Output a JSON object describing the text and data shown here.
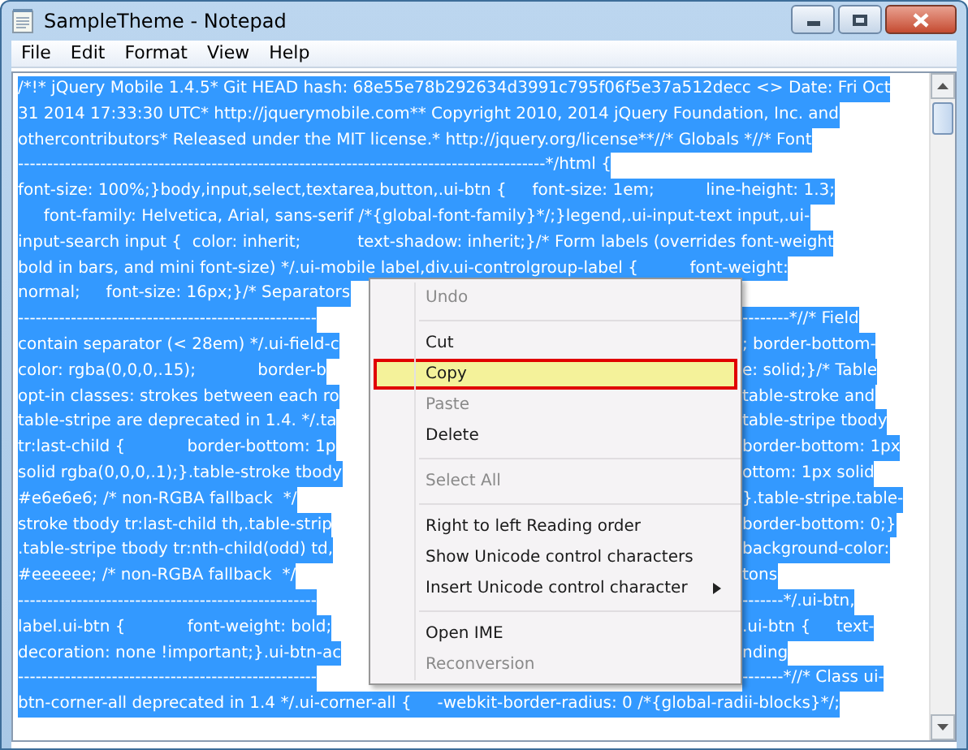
{
  "window": {
    "title": "SampleTheme - Notepad"
  },
  "menu_bar": [
    {
      "label": "File"
    },
    {
      "label": "Edit"
    },
    {
      "label": "Format"
    },
    {
      "label": "View"
    },
    {
      "label": "Help"
    }
  ],
  "editor": {
    "lines": [
      {
        "kind": "full",
        "text": "/*!* jQuery Mobile 1.4.5* Git HEAD hash: 68e55e78b292634d3991c795f06f5e37a512decc <> Date: Fri Oct"
      },
      {
        "kind": "full",
        "text": "31 2014 17:33:30 UTC* http://jquerymobile.com** Copyright 2010, 2014 jQuery Foundation, Inc. and"
      },
      {
        "kind": "full",
        "text": "othercontributors* Released under the MIT license.* http://jquery.org/license**//* Globals *//* Font"
      },
      {
        "kind": "full",
        "text": "------------------------------------------------------------------------------------------*/html {"
      },
      {
        "kind": "full",
        "text": "font-size: 100%;}body,input,select,textarea,button,.ui-btn {     font-size: 1em;          line-height: 1.3;"
      },
      {
        "kind": "full",
        "text": "     font-family: Helvetica, Arial, sans-serif /*{global-font-family}*/;}legend,.ui-input-text input,.ui-"
      },
      {
        "kind": "full",
        "text": "input-search input {  color: inherit;           text-shadow: inherit;}/* Form labels (overrides font-weight"
      },
      {
        "kind": "full",
        "text": "bold in bars, and mini font-size) */.ui-mobile label,div.ui-controlgroup-label {          font-weight:"
      },
      {
        "kind": "split",
        "left": "normal;     font-size: 16px;}/* Separators"
      },
      {
        "kind": "split",
        "left": "---------------------------------------------------",
        "right": "--------*//* Field"
      },
      {
        "kind": "split",
        "left": "contain separator (< 28em) */.ui-field-c",
        "right": "; border-bottom-"
      },
      {
        "kind": "split",
        "left": "color: rgba(0,0,0,.15);            border-b",
        "right": "e: solid;}/* Table"
      },
      {
        "kind": "split",
        "left": "opt-in classes: strokes between each ro",
        "right": "table-stroke and"
      },
      {
        "kind": "split",
        "left": "table-stripe are deprecated in 1.4. */.ta",
        "right": "table-stripe tbody"
      },
      {
        "kind": "split",
        "left": "tr:last-child {            border-bottom: 1p",
        "right": "border-bottom: 1px"
      },
      {
        "kind": "split",
        "left": "solid rgba(0,0,0,.1);}.table-stroke tbody",
        "right": "ottom: 1px solid"
      },
      {
        "kind": "split",
        "left": "#e6e6e6; /* non-RGBA fallback  */",
        "right": "}.table-stripe.table-"
      },
      {
        "kind": "split",
        "left": "stroke tbody tr:last-child th,.table-strip",
        "right": "border-bottom: 0;}"
      },
      {
        "kind": "split",
        "left": ".table-stripe tbody tr:nth-child(odd) td,",
        "right": "background-color:"
      },
      {
        "kind": "split",
        "left": "#eeeeee; /* non-RGBA fallback  */",
        "right": "tons"
      },
      {
        "kind": "split",
        "left": "---------------------------------------------------",
        "right": "-------*/.ui-btn,"
      },
      {
        "kind": "split",
        "left": "label.ui-btn {            font-weight: bold;",
        "right": ".ui-btn {     text-"
      },
      {
        "kind": "split",
        "left": "decoration: none !important;}.ui-btn-ac",
        "right": "nding"
      },
      {
        "kind": "split",
        "left": "---------------------------------------------------",
        "right": "-------*//* Class ui-"
      },
      {
        "kind": "full",
        "text": "btn-corner-all deprecated in 1.4 */.ui-corner-all {     -webkit-border-radius: 0 /*{global-radii-blocks}*/;"
      }
    ]
  },
  "context_menu": [
    {
      "kind": "item",
      "label": "Undo",
      "disabled": true,
      "selected": false
    },
    {
      "kind": "separator"
    },
    {
      "kind": "item",
      "label": "Cut",
      "disabled": false,
      "selected": false
    },
    {
      "kind": "item",
      "label": "Copy",
      "disabled": false,
      "selected": true
    },
    {
      "kind": "item",
      "label": "Paste",
      "disabled": true,
      "selected": false
    },
    {
      "kind": "item",
      "label": "Delete",
      "disabled": false,
      "selected": false
    },
    {
      "kind": "separator"
    },
    {
      "kind": "item",
      "label": "Select All",
      "disabled": true,
      "selected": false
    },
    {
      "kind": "separator"
    },
    {
      "kind": "item",
      "label": "Right to left Reading order",
      "disabled": false,
      "selected": false
    },
    {
      "kind": "item",
      "label": "Show Unicode control characters",
      "disabled": false,
      "selected": false
    },
    {
      "kind": "submenu",
      "label": "Insert Unicode control character",
      "disabled": false,
      "selected": false
    },
    {
      "kind": "separator"
    },
    {
      "kind": "item",
      "label": "Open IME",
      "disabled": false,
      "selected": false
    },
    {
      "kind": "item",
      "label": "Reconversion",
      "disabled": true,
      "selected": false
    }
  ]
}
